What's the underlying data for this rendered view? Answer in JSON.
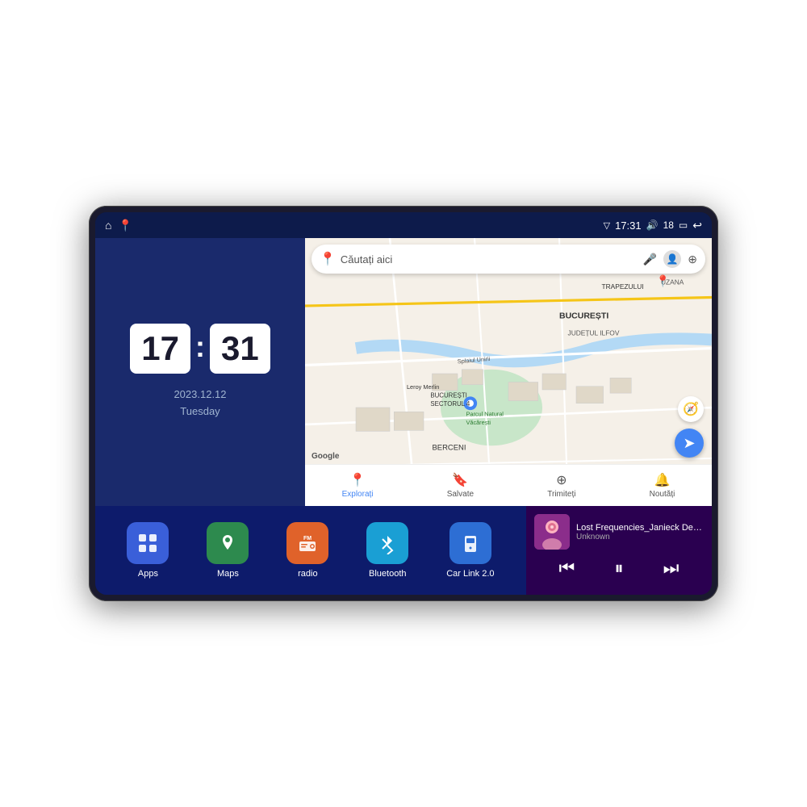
{
  "device": {
    "status_bar": {
      "left_icons": [
        "⌂",
        "📍"
      ],
      "signal_icon": "▽",
      "time": "17:31",
      "volume_icon": "🔊",
      "volume_level": "18",
      "battery_icon": "🔋",
      "back_icon": "↩"
    },
    "clock": {
      "hour": "17",
      "minute": "31",
      "date": "2023.12.12",
      "day": "Tuesday"
    },
    "map": {
      "search_placeholder": "Căutați aici",
      "nav_items": [
        {
          "label": "Explorați",
          "icon": "📍",
          "active": true
        },
        {
          "label": "Salvate",
          "icon": "🔖",
          "active": false
        },
        {
          "label": "Trimiteți",
          "icon": "⊕",
          "active": false
        },
        {
          "label": "Noutăți",
          "icon": "🔔",
          "active": false
        }
      ],
      "labels": {
        "parcul": "Parcul Natural Văcărești",
        "leroy": "Leroy Merlin",
        "bucuresti": "BUCUREȘTI",
        "trapezului": "TRAPEZULUI",
        "ilfov": "JUDEȚUL ILFOV",
        "berceni": "BERCENI",
        "sect4": "BUCUREȘTI\nSECTORUL 4",
        "uzana": "UZANA"
      }
    },
    "apps": [
      {
        "id": "apps",
        "label": "Apps",
        "icon": "⊞",
        "color": "#3a5fd9"
      },
      {
        "id": "maps",
        "label": "Maps",
        "icon": "🗺",
        "color": "#2d8a4e"
      },
      {
        "id": "radio",
        "label": "radio",
        "icon": "📻",
        "color": "#e0622a"
      },
      {
        "id": "bluetooth",
        "label": "Bluetooth",
        "icon": "⬡",
        "color": "#1a9fd4"
      },
      {
        "id": "carlink",
        "label": "Car Link 2.0",
        "icon": "📱",
        "color": "#2d6ed4"
      }
    ],
    "music": {
      "title": "Lost Frequencies_Janieck Devy-...",
      "artist": "Unknown",
      "prev_label": "⏮",
      "play_label": "⏸",
      "next_label": "⏭"
    }
  }
}
